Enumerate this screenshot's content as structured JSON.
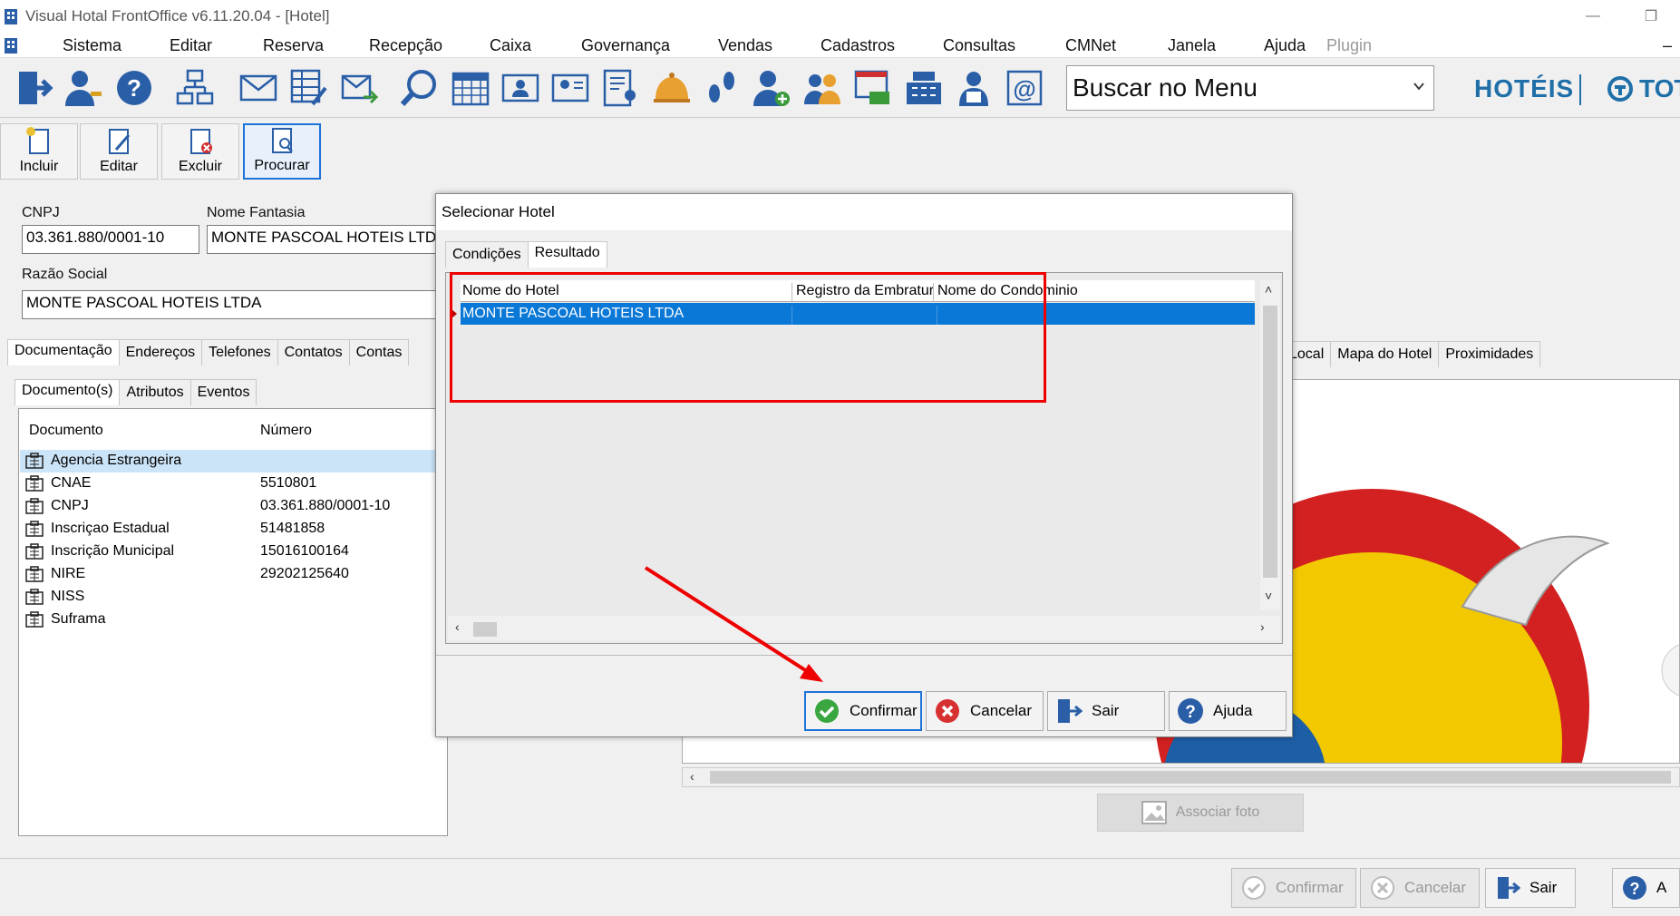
{
  "window": {
    "title": "Visual Hotal FrontOffice v6.11.20.04 - [Hotel]",
    "minimize": "—",
    "restore": "❐"
  },
  "menu": {
    "items": [
      "Sistema",
      "Editar",
      "Reserva",
      "Recepção",
      "Caixa",
      "Governança",
      "Vendas",
      "Cadastros",
      "Consultas",
      "CMNet",
      "Janela",
      "Ajuda",
      "Plugin"
    ],
    "close": "–"
  },
  "toolbar": {
    "search_menu": "Buscar no Menu",
    "brand": "HOTÉIS",
    "brand2": "TOT"
  },
  "crud": {
    "incluir": "Incluir",
    "editar": "Editar",
    "excluir": "Excluir",
    "procurar": "Procurar"
  },
  "form": {
    "cnpj_label": "CNPJ",
    "cnpj_value": "03.361.880/0001-10",
    "nome_fantasia_label": "Nome Fantasia",
    "nome_fantasia_value": "MONTE PASCOAL HOTEIS LTDA",
    "razao_social_label": "Razão Social",
    "razao_social_value": "MONTE PASCOAL HOTEIS LTDA"
  },
  "main_tabs": [
    "Documentação",
    "Endereços",
    "Telefones",
    "Contatos",
    "Contas"
  ],
  "right_tabs": [
    "Local",
    "Mapa do Hotel",
    "Proximidades"
  ],
  "sub_tabs": [
    "Documento(s)",
    "Atributos",
    "Eventos"
  ],
  "documents": {
    "col_documento": "Documento",
    "col_numero": "Número",
    "rows": [
      {
        "name": "Agencia Estrangeira",
        "value": ""
      },
      {
        "name": "CNAE",
        "value": "5510801"
      },
      {
        "name": "CNPJ",
        "value": "03.361.880/0001-10"
      },
      {
        "name": "Inscriçao Estadual",
        "value": "51481858"
      },
      {
        "name": "Inscrição Municipal",
        "value": "15016100164"
      },
      {
        "name": "NIRE",
        "value": "29202125640"
      },
      {
        "name": "NISS",
        "value": ""
      },
      {
        "name": "Suframa",
        "value": ""
      }
    ]
  },
  "photo": {
    "associar": "Associar foto"
  },
  "bottom": {
    "confirmar": "Confirmar",
    "cancelar": "Cancelar",
    "sair": "Sair",
    "ajuda": "A"
  },
  "dialog": {
    "title": "Selecionar Hotel",
    "tabs": [
      "Condições",
      "Resultado"
    ],
    "columns": [
      "Nome do Hotel",
      "Registro da Embratur",
      "Nome do Condominio"
    ],
    "row": {
      "hotel": "MONTE PASCOAL HOTEIS LTDA",
      "embratur": "",
      "condominio": ""
    },
    "confirmar": "Confirmar",
    "cancelar": "Cancelar",
    "sair": "Sair",
    "ajuda": "Ajuda"
  },
  "colors": {
    "selection": "#0a78d7",
    "annotation": "#e00000",
    "brand": "#1f6fa8"
  }
}
